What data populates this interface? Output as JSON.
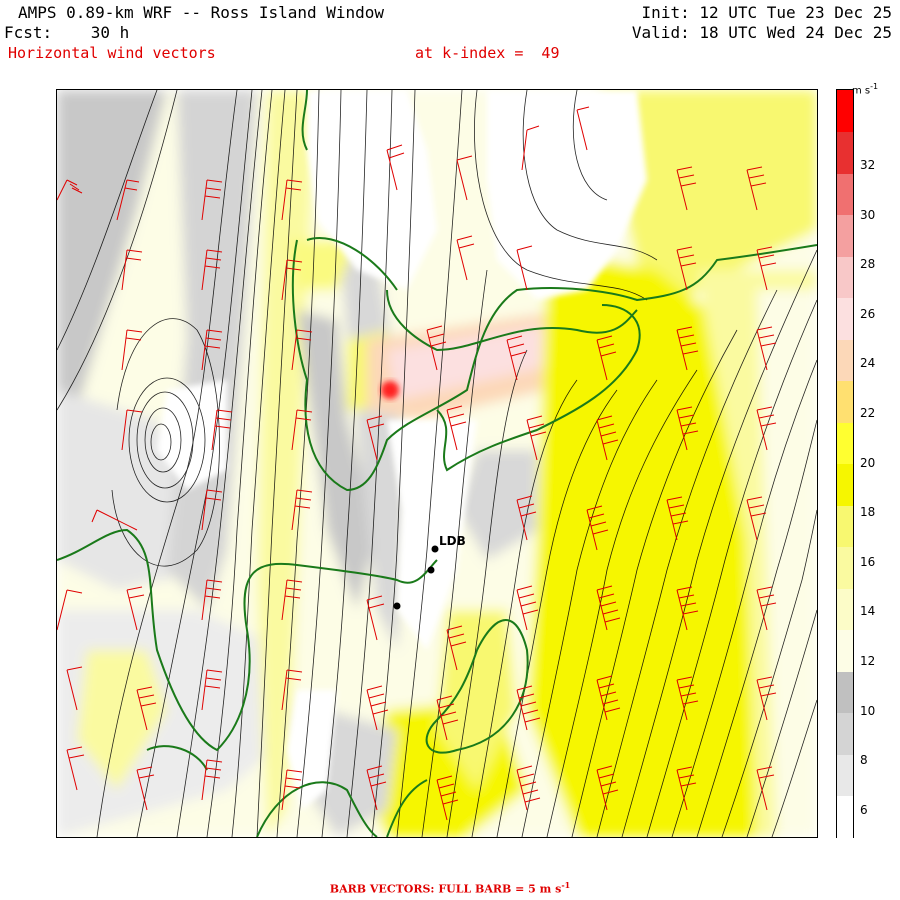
{
  "header": {
    "title": "AMPS 0.89-km WRF -- Ross Island Window",
    "fcst_label": "Fcst:",
    "fcst_value": "30 h",
    "init": "Init: 12 UTC Tue 23 Dec 25",
    "valid": "Valid: 18 UTC Wed 24 Dec 25",
    "field": "Horizontal wind vectors",
    "level": "at k-index =  49"
  },
  "colorbar": {
    "units": "m s",
    "units_exp": "-1",
    "ticks": [
      "32",
      "30",
      "28",
      "26",
      "24",
      "22",
      "20",
      "18",
      "16",
      "14",
      "12",
      "10",
      "8",
      "6"
    ],
    "colors": [
      "#ffffff",
      "#e8e8e8",
      "#d4d4d4",
      "#c0c0c0",
      "#fdfde6",
      "#fcfcc8",
      "#fafaa0",
      "#f8f870",
      "#f6f600",
      "#ffff30",
      "#ffe070",
      "#fcd8b8",
      "#fce0e0",
      "#f8c8c8",
      "#f4a0a0",
      "#f07070",
      "#e83030",
      "#ff0000"
    ]
  },
  "map": {
    "station_label": "LDB"
  },
  "footer": {
    "text": "BARB VECTORS:  FULL BARB = 5 m s",
    "exp": "-1"
  }
}
